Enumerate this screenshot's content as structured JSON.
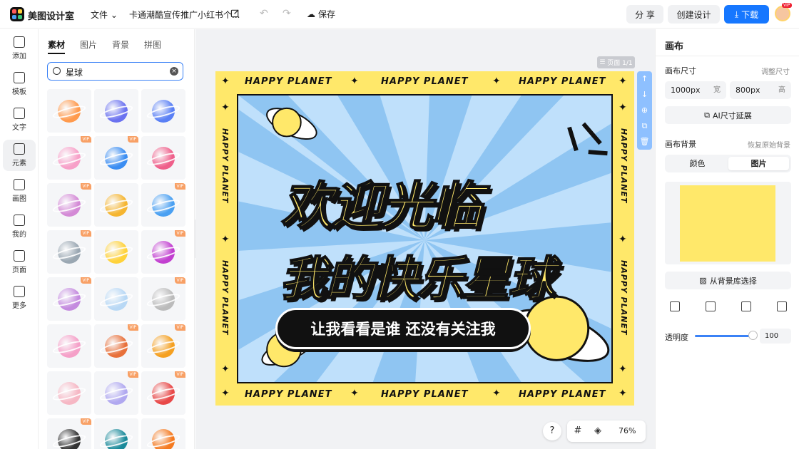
{
  "topbar": {
    "brand": "美图设计室",
    "file_menu": "文件",
    "doc_title": "卡通潮酷宣传推广小红书个...",
    "save_label": "保存",
    "share_label": "分 享",
    "create_label": "创建设计",
    "download_label": "下载",
    "avatar_badge": "VIP"
  },
  "leftnav": {
    "items": [
      {
        "label": "添加",
        "icon": "plus-icon"
      },
      {
        "label": "模板",
        "icon": "template-icon"
      },
      {
        "label": "文字",
        "icon": "text-icon"
      },
      {
        "label": "元素",
        "icon": "shapes-icon",
        "active": true
      },
      {
        "label": "画图",
        "icon": "draw-icon"
      },
      {
        "label": "我的",
        "icon": "user-icon"
      },
      {
        "label": "页面",
        "icon": "page-add-icon"
      },
      {
        "label": "更多",
        "icon": "cube-icon"
      }
    ]
  },
  "panel": {
    "tabs": [
      "素材",
      "图片",
      "背景",
      "拼图"
    ],
    "active_tab": "素材",
    "search_value": "星球",
    "vip_label": "VIP",
    "thumb_colors": [
      "#ff9a4d",
      "#6b72f0",
      "#5a80f5",
      "#f7a0c8",
      "#3a8df2",
      "#ef5f8a",
      "#d48ad6",
      "#f5b530",
      "#4aa0f2",
      "#9aa7b2",
      "#ffd23a",
      "#c23fd0",
      "#c48adf",
      "#b8d8f5",
      "#bbbbbb",
      "#f5a0c8",
      "#e8703a",
      "#f5a020",
      "#f6b7c4",
      "#b0a8f0",
      "#e84848",
      "#333333",
      "#1a8a9a",
      "#f57a20"
    ],
    "vip_cells": [
      3,
      4,
      6,
      8,
      9,
      11,
      12,
      14,
      16,
      17,
      19,
      20,
      21
    ]
  },
  "canvas": {
    "page_label": "页面 1/1",
    "happy_planet": "HAPPY PLANET",
    "headline1": "欢迎光临",
    "headline2": "我的快乐星球",
    "pill_text": "让我看看是谁 还没有关注我",
    "bg_color": "#ffe86a"
  },
  "zoom": {
    "help": "?",
    "value": "76%"
  },
  "rightpanel": {
    "title": "画布",
    "size_label": "画布尺寸",
    "resize_link": "调整尺寸",
    "width_value": "1000px",
    "width_unit": "宽",
    "height_value": "800px",
    "height_unit": "高",
    "ai_extend_label": "AI尺寸延展",
    "bg_label": "画布背景",
    "restore_link": "恢复原始背景",
    "seg_color": "颜色",
    "seg_image": "图片",
    "choose_bg_label": "从背景库选择",
    "opacity_label": "透明度",
    "opacity_value": "100",
    "swatch_color": "#ffe86a"
  }
}
